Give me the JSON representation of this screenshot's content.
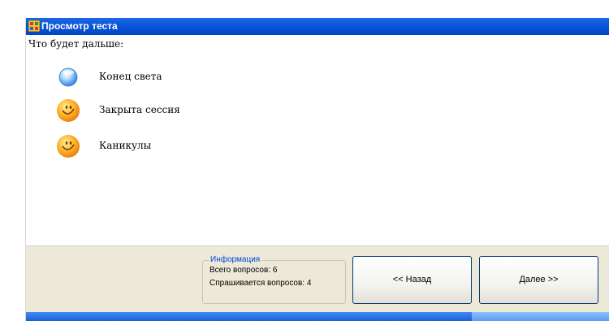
{
  "window": {
    "title": "Просмотр теста"
  },
  "question": {
    "text": "Что будет дальше:"
  },
  "answers": [
    {
      "label": "Конец света",
      "icon": "blue-sphere-icon"
    },
    {
      "label": "Закрыта сессия",
      "icon": "smiley-face-icon"
    },
    {
      "label": "Каникулы",
      "icon": "smiley-face-icon"
    }
  ],
  "info": {
    "legend": "Информация",
    "total": "Всего вопросов: 6",
    "asked": "Спрашивается вопросов: 4"
  },
  "buttons": {
    "back": "<< Назад",
    "next": "Далее >>"
  },
  "colors": {
    "titlebar": "#0a55d8",
    "panel": "#ece9d8",
    "legend": "#0046d5"
  }
}
